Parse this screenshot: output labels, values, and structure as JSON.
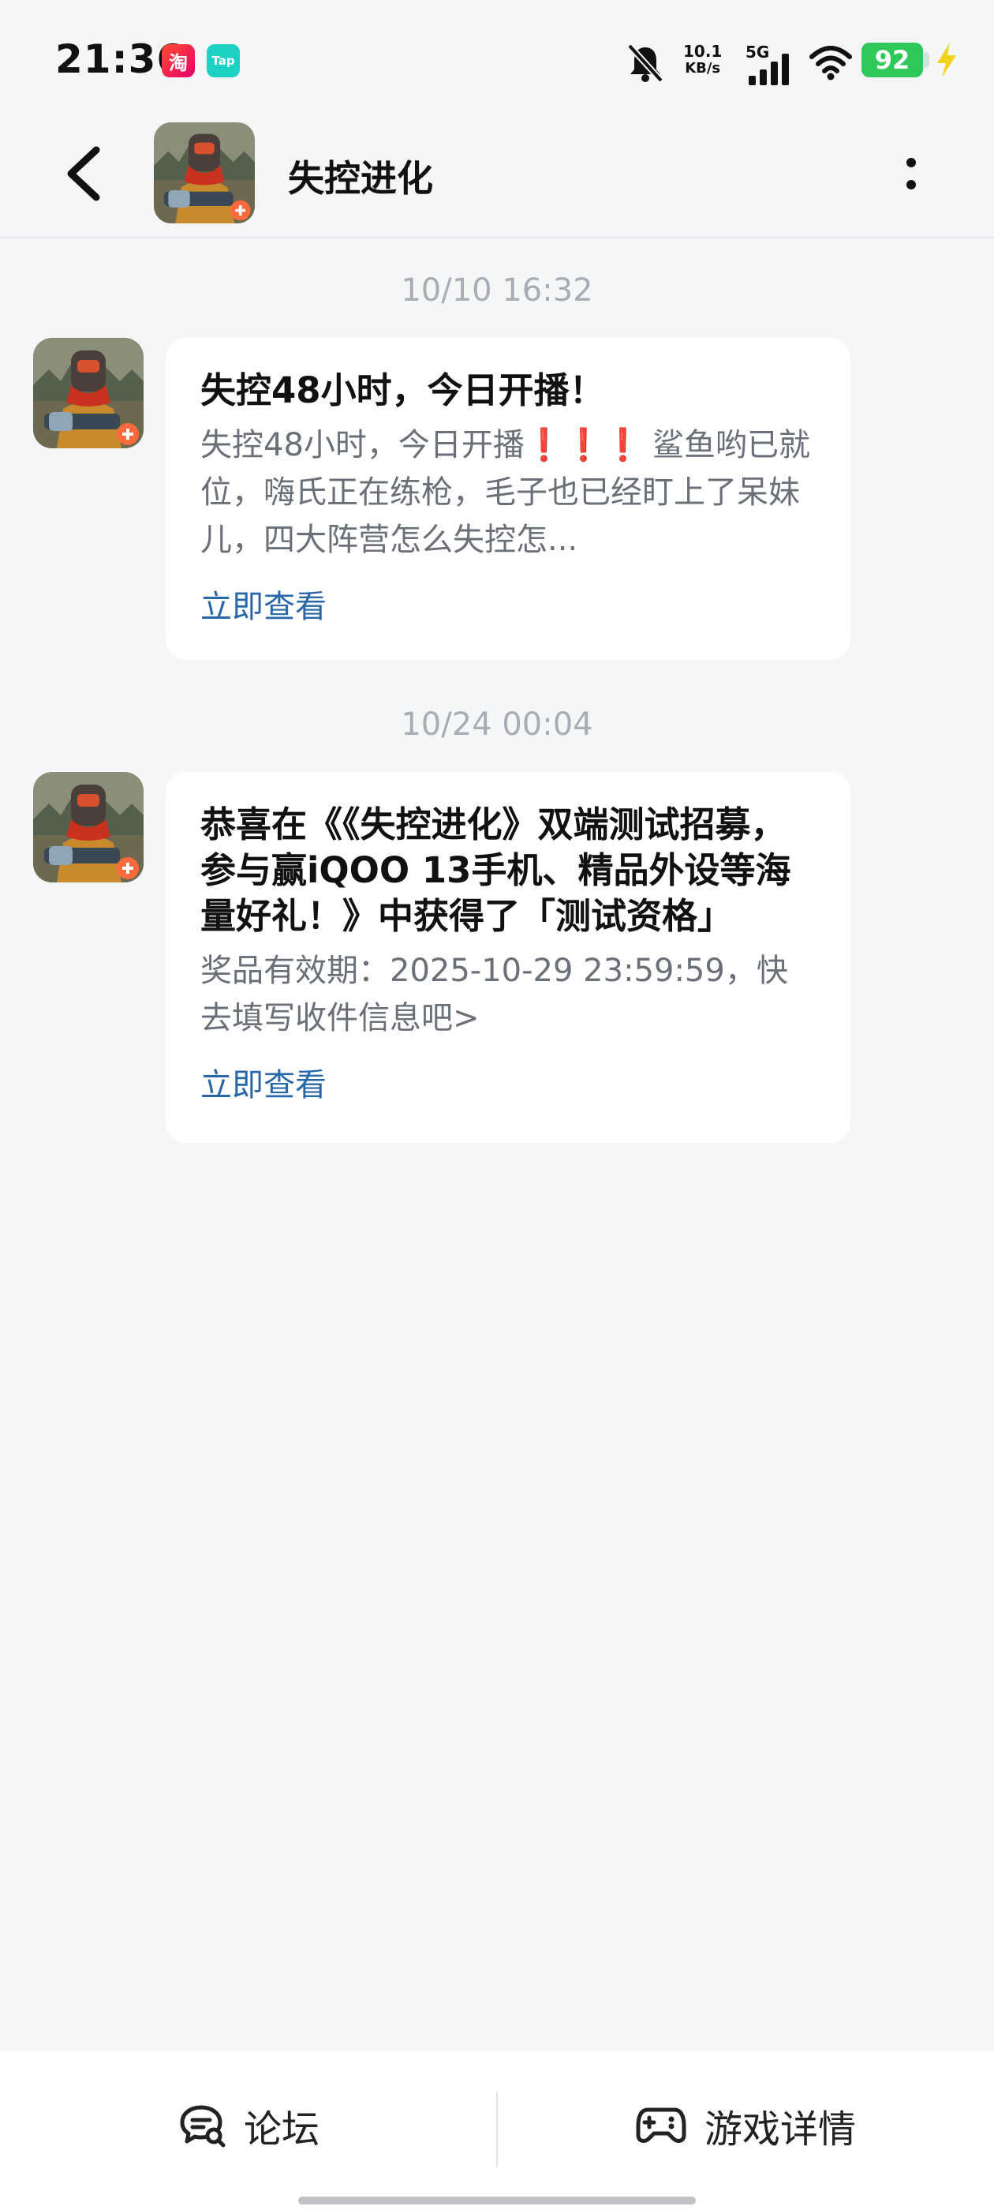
{
  "status_bar": {
    "time": "21:36",
    "taobao_badge": "淘",
    "tap_badge": "Tap",
    "network_speed_value": "10.1",
    "network_speed_unit": "KB/s",
    "network_type": "5G",
    "battery_level": "92",
    "icons": [
      "mute-bell-icon",
      "signal-icon",
      "wifi-icon",
      "battery-icon",
      "charging-icon"
    ]
  },
  "header": {
    "title": "失控进化",
    "icons": [
      "back-arrow-icon",
      "more-dots-icon"
    ]
  },
  "messages": [
    {
      "timestamp": "10/10  16:32",
      "title": "失控48小时，今日开播！",
      "body_before": "失控48小时，今日开播",
      "exclamations": "❗❗❗",
      "body_after": " 鲨鱼哟已就位，嗨氏正在练枪，毛子也已经盯上了呆妹儿，四大阵营怎么失控怎...",
      "link": "立即查看"
    },
    {
      "timestamp": "10/24  00:04",
      "title": "恭喜在《《失控进化》双端测试招募，参与赢iQOO 13手机、精品外设等海量好礼！》中获得了「测试资格」",
      "body": "奖品有效期：2025-10-29 23:59:59，快去填写收件信息吧>",
      "link": "立即查看"
    }
  ],
  "bottom_tabs": [
    {
      "label": "论坛",
      "icon": "forum-chat-icon"
    },
    {
      "label": "游戏详情",
      "icon": "gamepad-icon"
    }
  ],
  "colors": {
    "background": "#f5f6f8",
    "card": "#ffffff",
    "link": "#2867a8",
    "timestamp": "#a8adb5",
    "battery": "#31c85a"
  }
}
